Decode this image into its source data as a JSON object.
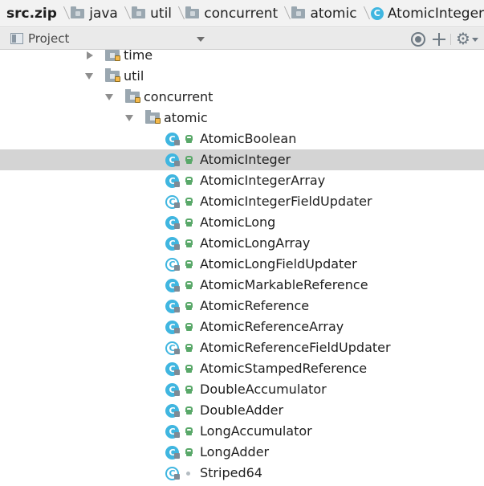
{
  "breadcrumb": {
    "items": [
      {
        "label": "src.zip",
        "icon": "archive"
      },
      {
        "label": "java",
        "icon": "folder-icon"
      },
      {
        "label": "util",
        "icon": "folder-icon"
      },
      {
        "label": "concurrent",
        "icon": "folder-icon"
      },
      {
        "label": "atomic",
        "icon": "folder-icon"
      },
      {
        "label": "AtomicInteger",
        "icon": "class-icon"
      }
    ]
  },
  "toolbar": {
    "view_label": "Project",
    "icons": [
      "locate-icon",
      "collapse-all-icon",
      "settings-icon"
    ]
  },
  "tree": {
    "packages": [
      {
        "label": "time",
        "expanded": false
      },
      {
        "label": "util",
        "expanded": true
      },
      {
        "label": "concurrent",
        "expanded": true
      },
      {
        "label": "atomic",
        "expanded": true
      }
    ],
    "classes": [
      {
        "label": "AtomicBoolean",
        "kind": "class"
      },
      {
        "label": "AtomicInteger",
        "kind": "class",
        "selected": true
      },
      {
        "label": "AtomicIntegerArray",
        "kind": "class"
      },
      {
        "label": "AtomicIntegerFieldUpdater",
        "kind": "abstract"
      },
      {
        "label": "AtomicLong",
        "kind": "class"
      },
      {
        "label": "AtomicLongArray",
        "kind": "class"
      },
      {
        "label": "AtomicLongFieldUpdater",
        "kind": "abstract"
      },
      {
        "label": "AtomicMarkableReference",
        "kind": "class"
      },
      {
        "label": "AtomicReference",
        "kind": "class"
      },
      {
        "label": "AtomicReferenceArray",
        "kind": "class"
      },
      {
        "label": "AtomicReferenceFieldUpdater",
        "kind": "abstract"
      },
      {
        "label": "AtomicStampedReference",
        "kind": "class"
      },
      {
        "label": "DoubleAccumulator",
        "kind": "class"
      },
      {
        "label": "DoubleAdder",
        "kind": "class"
      },
      {
        "label": "LongAccumulator",
        "kind": "class"
      },
      {
        "label": "LongAdder",
        "kind": "class"
      },
      {
        "label": "Striped64",
        "kind": "abstract"
      }
    ]
  },
  "colors": {
    "class_icon": "#40b6e0",
    "public_lock": "#59a869",
    "selection": "#d4d4d4",
    "folder": "#9aa7b0"
  }
}
